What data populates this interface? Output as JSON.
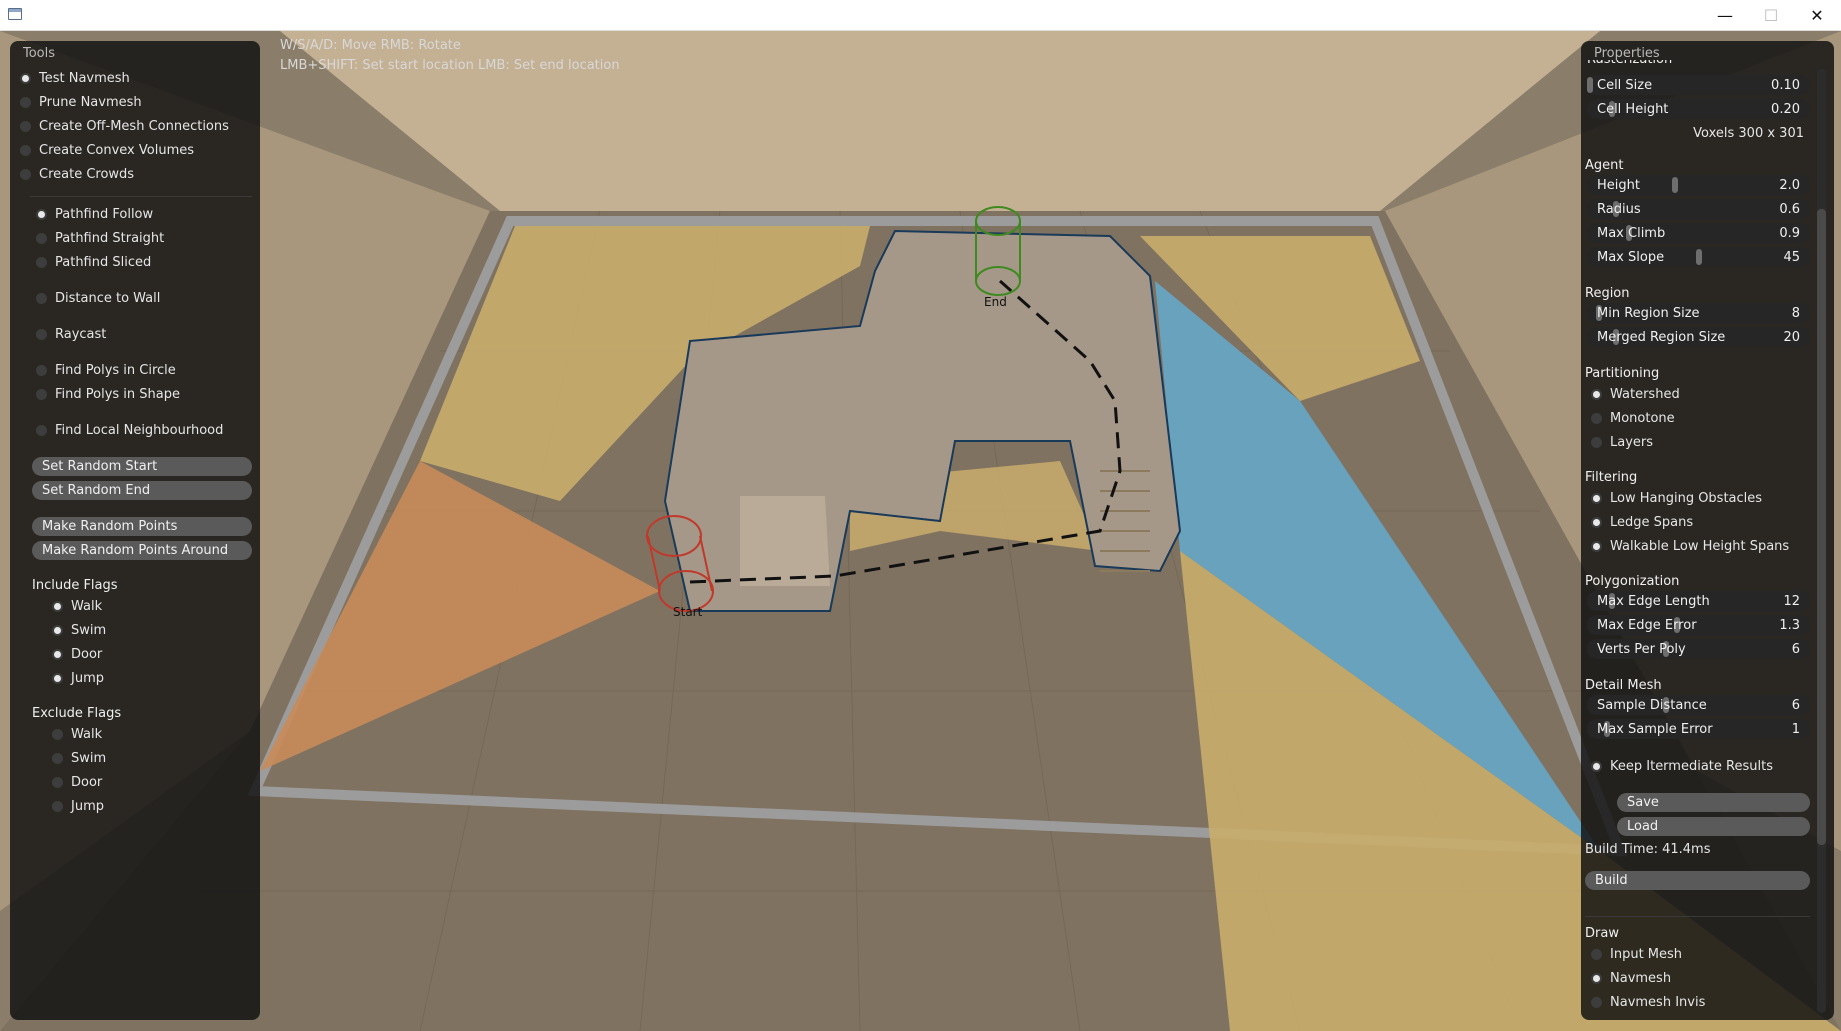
{
  "window": {
    "minimize": "—",
    "maximize": "☐",
    "close": "✕"
  },
  "hints": {
    "line1": "W/S/A/D: Move  RMB: Rotate",
    "line2": "LMB+SHIFT: Set start location  LMB: Set end location"
  },
  "scene": {
    "start_label": "Start",
    "end_label": "End",
    "colors": {
      "floor": "#8a7d6a",
      "walls": "#c4b093",
      "nav_yellow": "#c9ad6c",
      "nav_blue": "#67a6c6",
      "nav_orange": "#c98b59",
      "nav_green": "#a9b65a",
      "start_marker": "#c0392b",
      "end_marker": "#3e8a1f"
    }
  },
  "tools": {
    "title": "Tools",
    "modes": [
      {
        "label": "Test Navmesh",
        "selected": true
      },
      {
        "label": "Prune Navmesh",
        "selected": false
      },
      {
        "label": "Create Off-Mesh Connections",
        "selected": false
      },
      {
        "label": "Create Convex Volumes",
        "selected": false
      },
      {
        "label": "Create Crowds",
        "selected": false
      }
    ],
    "query_modes": [
      {
        "label": "Pathfind Follow",
        "selected": true
      },
      {
        "label": "Pathfind Straight",
        "selected": false
      },
      {
        "label": "Pathfind Sliced",
        "selected": false
      },
      {
        "label": "Distance to Wall",
        "selected": false
      },
      {
        "label": "Raycast",
        "selected": false
      },
      {
        "label": "Find Polys in Circle",
        "selected": false
      },
      {
        "label": "Find Polys in Shape",
        "selected": false
      },
      {
        "label": "Find Local Neighbourhood",
        "selected": false
      }
    ],
    "buttons": {
      "set_random_start": "Set Random Start",
      "set_random_end": "Set Random End",
      "make_random_points": "Make Random Points",
      "make_random_points_around": "Make Random Points Around"
    },
    "include_flags_title": "Include Flags",
    "include_flags": [
      {
        "label": "Walk",
        "checked": true
      },
      {
        "label": "Swim",
        "checked": true
      },
      {
        "label": "Door",
        "checked": true
      },
      {
        "label": "Jump",
        "checked": true
      }
    ],
    "exclude_flags_title": "Exclude Flags",
    "exclude_flags": [
      {
        "label": "Walk",
        "checked": false
      },
      {
        "label": "Swim",
        "checked": false
      },
      {
        "label": "Door",
        "checked": false
      },
      {
        "label": "Jump",
        "checked": false
      }
    ]
  },
  "properties": {
    "title": "Properties",
    "cut_heading": "Rasterization",
    "cell_size": {
      "label": "Cell Size",
      "value": "0.10",
      "level": 0.0
    },
    "cell_height": {
      "label": "Cell Height",
      "value": "0.20",
      "level": 0.1
    },
    "voxels": "Voxels  300 x 301",
    "agent_title": "Agent",
    "agent": [
      {
        "label": "Height",
        "value": "2.0",
        "level": 0.39
      },
      {
        "label": "Radius",
        "value": "0.6",
        "level": 0.12
      },
      {
        "label": "Max Climb",
        "value": "0.9",
        "level": 0.18
      },
      {
        "label": "Max Slope",
        "value": "45",
        "level": 0.5
      }
    ],
    "region_title": "Region",
    "region": [
      {
        "label": "Min Region Size",
        "value": "8",
        "level": 0.04
      },
      {
        "label": "Merged Region Size",
        "value": "20",
        "level": 0.12
      }
    ],
    "partitioning_title": "Partitioning",
    "partitioning": [
      {
        "label": "Watershed",
        "selected": true
      },
      {
        "label": "Monotone",
        "selected": false
      },
      {
        "label": "Layers",
        "selected": false
      }
    ],
    "filtering_title": "Filtering",
    "filtering": [
      {
        "label": "Low Hanging Obstacles",
        "checked": true
      },
      {
        "label": "Ledge Spans",
        "checked": true
      },
      {
        "label": "Walkable Low Height Spans",
        "checked": true
      }
    ],
    "polygonization_title": "Polygonization",
    "polygonization": [
      {
        "label": "Max Edge Length",
        "value": "12",
        "level": 0.1
      },
      {
        "label": "Max Edge Error",
        "value": "1.3",
        "level": 0.4
      },
      {
        "label": "Verts Per Poly",
        "value": "6",
        "level": 0.35
      }
    ],
    "detail_title": "Detail Mesh",
    "detail": [
      {
        "label": "Sample Distance",
        "value": "6",
        "level": 0.35
      },
      {
        "label": "Max Sample Error",
        "value": "1",
        "level": 0.08
      }
    ],
    "keep_intermediate": {
      "label": "Keep Itermediate Results",
      "checked": true
    },
    "save_label": "Save",
    "load_label": "Load",
    "build_time": "Build Time: 41.4ms",
    "build_label": "Build",
    "draw_title": "Draw",
    "draw": [
      {
        "label": "Input Mesh",
        "selected": false
      },
      {
        "label": "Navmesh",
        "selected": true
      },
      {
        "label": "Navmesh Invis",
        "selected": false
      }
    ]
  }
}
